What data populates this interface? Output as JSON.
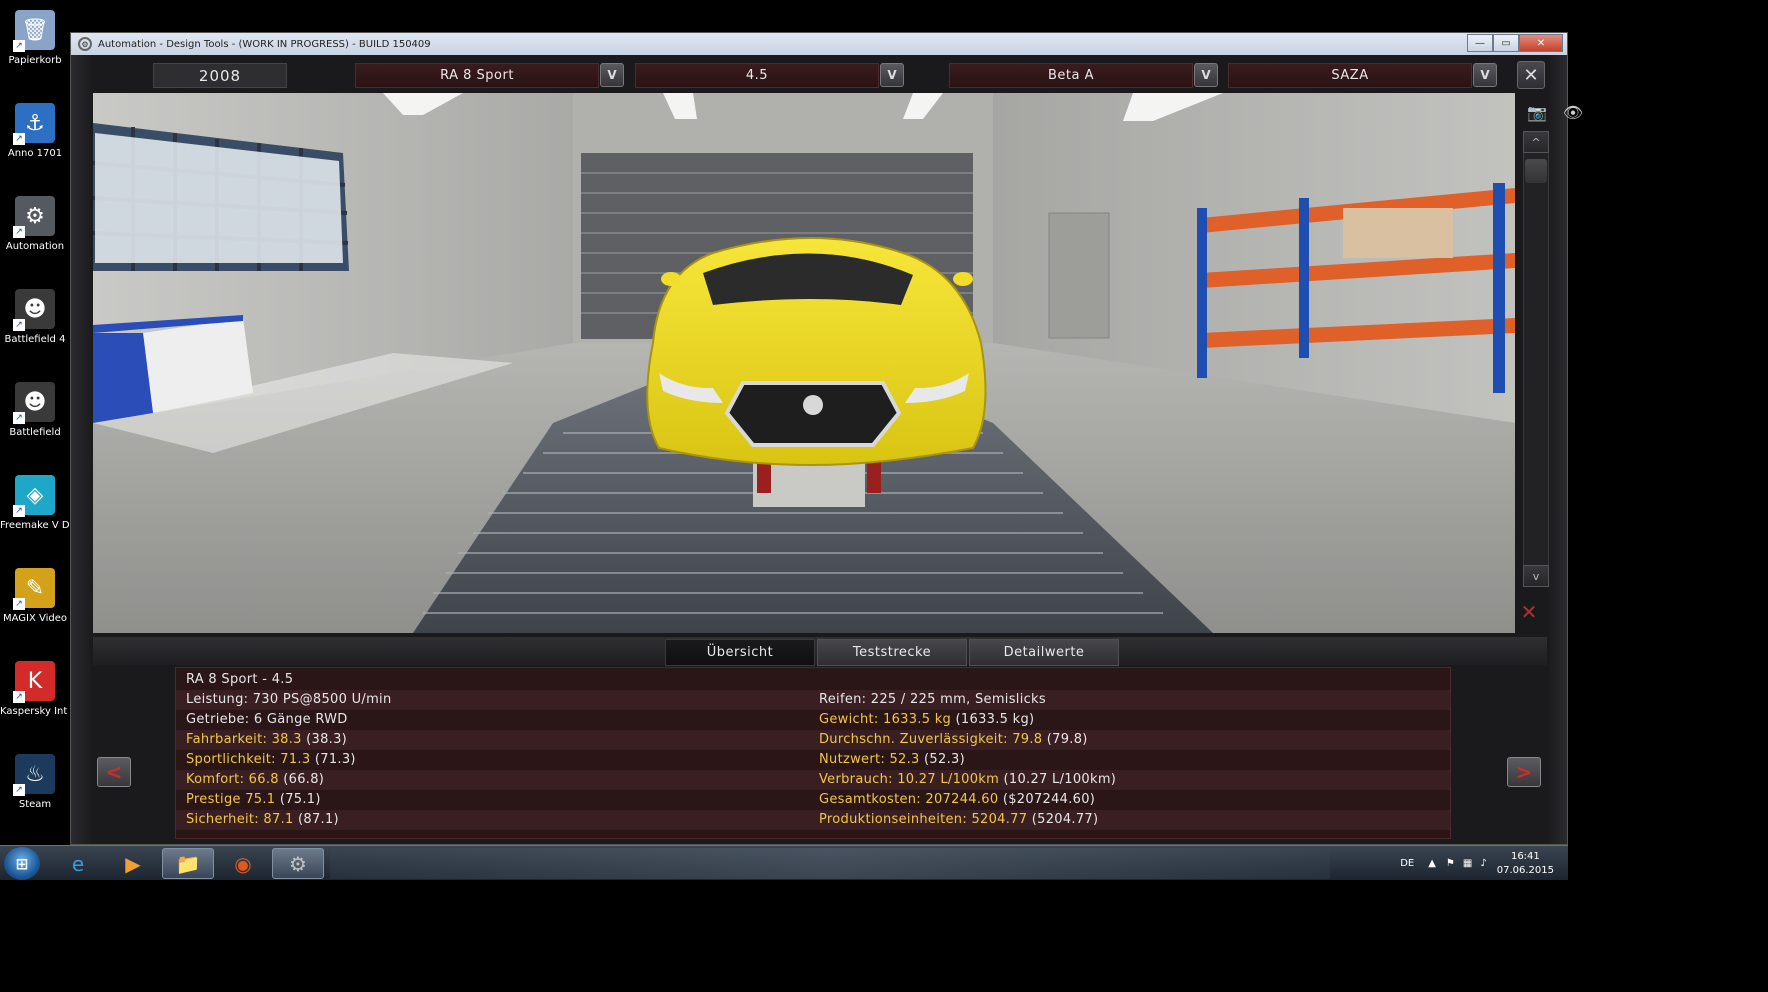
{
  "desktop": {
    "icons": [
      {
        "label": "Papierkorb",
        "icon": "recycle-bin-icon",
        "color": "#8aa4c8",
        "glyph": "🗑"
      },
      {
        "label": "Anno 1701",
        "icon": "anno-icon",
        "color": "#2d6fc2",
        "glyph": "⚓"
      },
      {
        "label": "Automation",
        "icon": "automation-icon",
        "color": "#555a60",
        "glyph": "⚙"
      },
      {
        "label": "Battlefield 4",
        "icon": "battlefield-icon",
        "color": "#3a3a3a",
        "glyph": "☻"
      },
      {
        "label": "Battlefield",
        "icon": "battlefield-icon",
        "color": "#3a3a3a",
        "glyph": "☻"
      },
      {
        "label": "Freemake V Download",
        "icon": "freemake-icon",
        "color": "#1fa7c9",
        "glyph": "◈"
      },
      {
        "label": "MAGIX Video",
        "icon": "magix-icon",
        "color": "#d4a21a",
        "glyph": "✎"
      },
      {
        "label": "Kaspersky Int Security",
        "icon": "kaspersky-icon",
        "color": "#d32a2a",
        "glyph": "K"
      },
      {
        "label": "Steam",
        "icon": "steam-icon",
        "color": "#1c3a5c",
        "glyph": "♨"
      }
    ]
  },
  "window": {
    "title": "Automation - Design Tools - (WORK IN PROGRESS) - BUILD 150409",
    "minimize": "—",
    "maximize": "▭",
    "close": "✕"
  },
  "topbar": {
    "year": "2008",
    "model": "RA 8 Sport",
    "trim": "4.5",
    "body": "Beta A",
    "family": "SAZA",
    "dropdown_glyph": "V",
    "close_glyph": "✕"
  },
  "viewport_tools": {
    "camera": "📷",
    "view_eye": "👁",
    "scroll_up": "^",
    "scroll_down": "v",
    "car_views": [
      "🚘",
      "🚗",
      "🚙",
      "🚕"
    ],
    "reset": "✕"
  },
  "tabs": [
    {
      "label": "Übersicht",
      "active": true
    },
    {
      "label": "Teststrecke",
      "active": false
    },
    {
      "label": "Detailwerte",
      "active": false
    }
  ],
  "info": {
    "title": "RA 8 Sport - 4.5",
    "left": [
      {
        "label": "Leistung: 730 PS@8500 U/min",
        "hl": ""
      },
      {
        "label": "Getriebe: 6 Gänge RWD",
        "hl": ""
      },
      {
        "label": "Fahrbarkeit: 38.3",
        "rest": " (38.3)"
      },
      {
        "label": "Sportlichkeit: 71.3",
        "rest": " (71.3)"
      },
      {
        "label": "Komfort: 66.8",
        "rest": " (66.8)"
      },
      {
        "label": "Prestige 75.1",
        "rest": " (75.1)"
      },
      {
        "label": "Sicherheit: 87.1",
        "rest": " (87.1)"
      }
    ],
    "right": [
      {
        "label": "Reifen: 225 / 225 mm, Semislicks",
        "hl": ""
      },
      {
        "label": "Gewicht: 1633.5 kg",
        "rest": " (1633.5 kg)"
      },
      {
        "label": "Durchschn. Zuverlässigkeit: 79.8",
        "rest": " (79.8)"
      },
      {
        "label": "Nutzwert: 52.3",
        "rest": " (52.3)"
      },
      {
        "label": "Verbrauch: 10.27 L/100km",
        "rest": " (10.27 L/100km)"
      },
      {
        "label": "Gesamtkosten: 207244.60",
        "rest": " ($207244.60)"
      },
      {
        "label": "Produktionseinheiten: 5204.77",
        "rest": " (5204.77)"
      }
    ],
    "prev": "<",
    "next": ">"
  },
  "taskbar": {
    "start": "⊞",
    "apps": [
      {
        "icon": "internet-explorer-icon",
        "glyph": "e",
        "color": "#3a9ae0"
      },
      {
        "icon": "media-player-icon",
        "glyph": "▶",
        "color": "#f0a030"
      },
      {
        "icon": "explorer-icon",
        "glyph": "📁",
        "color": "#e8c060"
      },
      {
        "icon": "firefox-icon",
        "glyph": "◉",
        "color": "#e05a20"
      },
      {
        "icon": "automation-task-icon",
        "glyph": "⚙",
        "color": "#c0c0c0"
      }
    ],
    "lang": "DE",
    "time": "16:41",
    "date": "07.06.2015"
  }
}
